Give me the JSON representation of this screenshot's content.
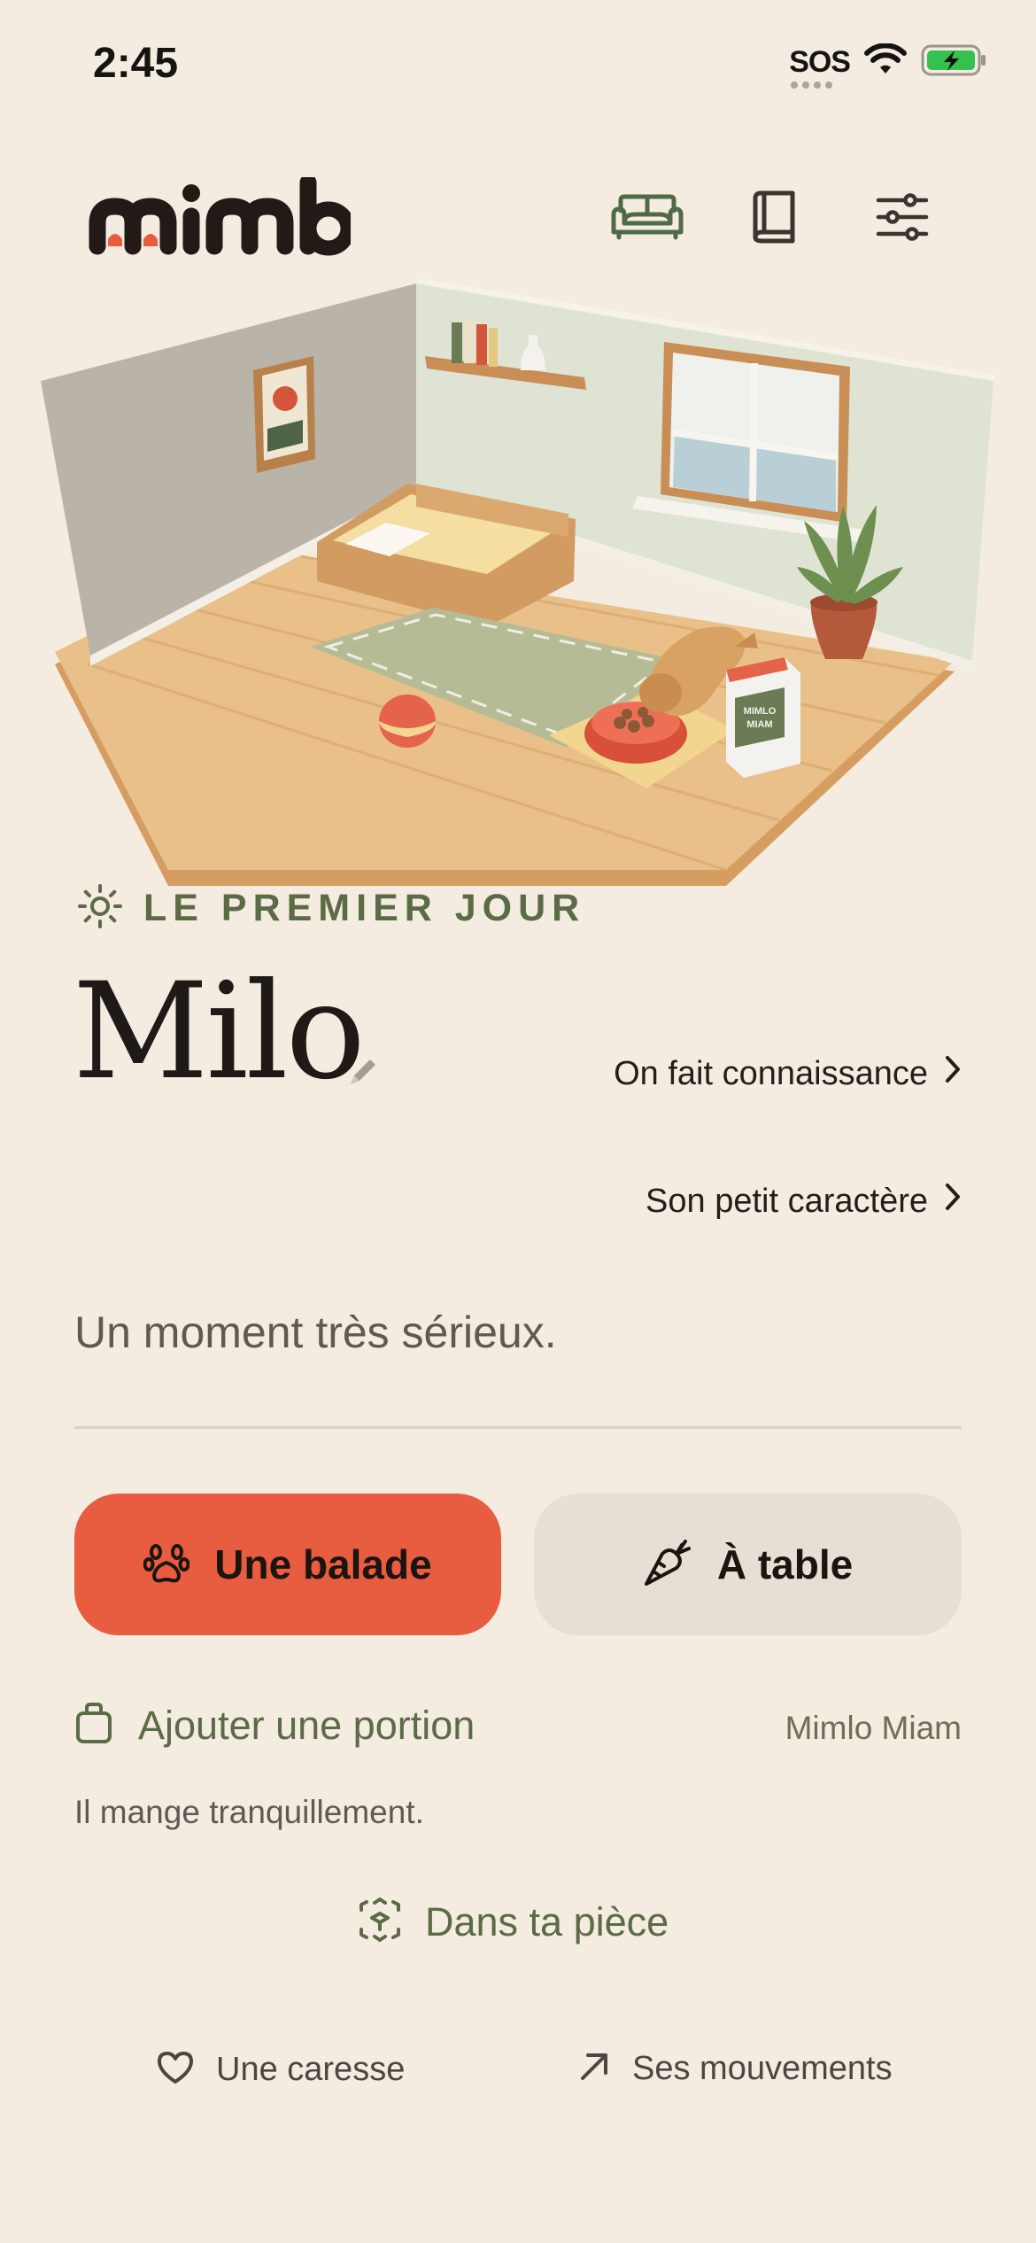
{
  "status_bar": {
    "time": "2:45",
    "sos": "SOS",
    "icons": [
      "wifi-icon",
      "battery-charging-icon"
    ]
  },
  "header": {
    "logo_text": "mimlo",
    "icons": [
      "sofa-icon",
      "book-icon",
      "sliders-icon"
    ]
  },
  "scene": {
    "food_bag_label_line1": "MIMLO",
    "food_bag_label_line2": "MIAM"
  },
  "phase": {
    "icon": "sun-icon",
    "label": "LE PREMIER JOUR"
  },
  "pet": {
    "name": "Milo"
  },
  "links": {
    "get_to_know": "On fait connaissance",
    "character": "Son petit caractère"
  },
  "mood": "Un moment très sérieux.",
  "actions": {
    "walk_label": "Une balade",
    "table_label": "À table",
    "walk_color": "#e85d3f",
    "table_color": "#e7dfd3"
  },
  "food": {
    "add_portion": "Ajouter une portion",
    "brand": "Mimlo Miam",
    "status": "Il mange tranquillement."
  },
  "ar": {
    "label": "Dans ta pièce"
  },
  "footer": {
    "pet_label": "Une caresse",
    "moves_label": "Ses mouvements"
  },
  "colors": {
    "background": "#f4ece0",
    "accent_green": "#5b6b45",
    "accent_red": "#e85d3f"
  }
}
